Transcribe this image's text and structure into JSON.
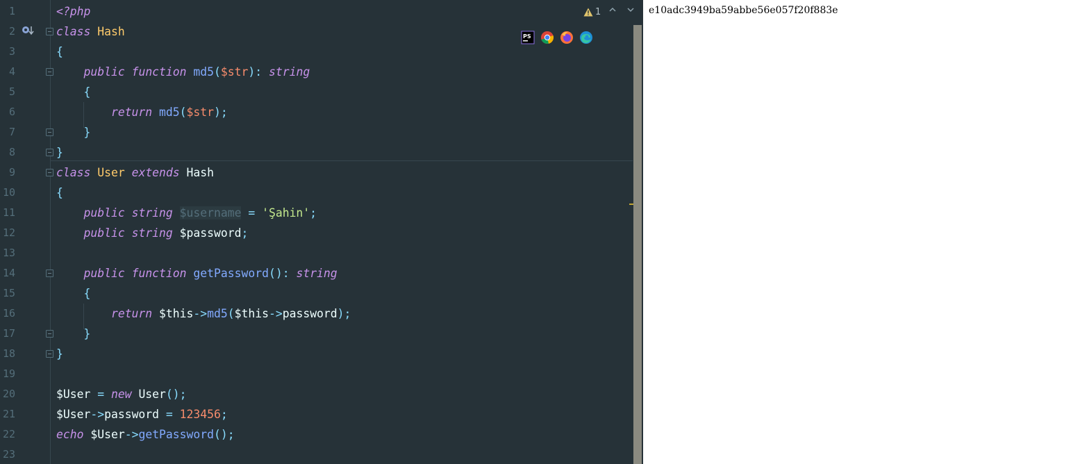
{
  "editor": {
    "line_numbers": [
      "1",
      "2",
      "3",
      "4",
      "5",
      "6",
      "7",
      "8",
      "9",
      "10",
      "11",
      "12",
      "13",
      "14",
      "15",
      "16",
      "17",
      "18",
      "19",
      "20",
      "21",
      "22",
      "23"
    ],
    "inspection": {
      "count": "1"
    },
    "browser_icons": [
      "phpstorm-icon",
      "chrome-icon",
      "firefox-icon",
      "edge-icon"
    ],
    "lines": [
      [
        {
          "t": "<?php",
          "c": "php"
        }
      ],
      [
        {
          "t": "class",
          "c": "kw"
        },
        {
          "t": " ",
          "c": "base"
        },
        {
          "t": "Hash",
          "c": "cls"
        }
      ],
      [
        {
          "t": "{",
          "c": "op"
        }
      ],
      [
        {
          "t": "    ",
          "c": "base"
        },
        {
          "t": "public",
          "c": "kw"
        },
        {
          "t": " ",
          "c": "base"
        },
        {
          "t": "function",
          "c": "kw"
        },
        {
          "t": " ",
          "c": "base"
        },
        {
          "t": "md5",
          "c": "fn"
        },
        {
          "t": "(",
          "c": "op"
        },
        {
          "t": "$str",
          "c": "var"
        },
        {
          "t": "): ",
          "c": "op"
        },
        {
          "t": "string",
          "c": "kw"
        }
      ],
      [
        {
          "t": "    ",
          "c": "base"
        },
        {
          "t": "{",
          "c": "op"
        }
      ],
      [
        {
          "t": "        ",
          "c": "base"
        },
        {
          "t": "return",
          "c": "kw"
        },
        {
          "t": " ",
          "c": "base"
        },
        {
          "t": "md5",
          "c": "fn"
        },
        {
          "t": "(",
          "c": "op"
        },
        {
          "t": "$str",
          "c": "var"
        },
        {
          "t": ");",
          "c": "op"
        }
      ],
      [
        {
          "t": "    ",
          "c": "base"
        },
        {
          "t": "}",
          "c": "op"
        }
      ],
      [
        {
          "t": "}",
          "c": "op"
        }
      ],
      [
        {
          "t": "class",
          "c": "kw"
        },
        {
          "t": " ",
          "c": "base"
        },
        {
          "t": "User",
          "c": "cls"
        },
        {
          "t": " ",
          "c": "base"
        },
        {
          "t": "extends",
          "c": "kw"
        },
        {
          "t": " ",
          "c": "base"
        },
        {
          "t": "Hash",
          "c": "plain"
        }
      ],
      [
        {
          "t": "{",
          "c": "op"
        }
      ],
      [
        {
          "t": "    ",
          "c": "base"
        },
        {
          "t": "public",
          "c": "kw"
        },
        {
          "t": " ",
          "c": "base"
        },
        {
          "t": "string",
          "c": "kw"
        },
        {
          "t": " ",
          "c": "base"
        },
        {
          "t": "$username",
          "c": "dim"
        },
        {
          "t": " = ",
          "c": "op"
        },
        {
          "t": "'Şahin'",
          "c": "str"
        },
        {
          "t": ";",
          "c": "op"
        }
      ],
      [
        {
          "t": "    ",
          "c": "base"
        },
        {
          "t": "public",
          "c": "kw"
        },
        {
          "t": " ",
          "c": "base"
        },
        {
          "t": "string",
          "c": "kw"
        },
        {
          "t": " ",
          "c": "base"
        },
        {
          "t": "$password",
          "c": "plain"
        },
        {
          "t": ";",
          "c": "op"
        }
      ],
      [],
      [
        {
          "t": "    ",
          "c": "base"
        },
        {
          "t": "public",
          "c": "kw"
        },
        {
          "t": " ",
          "c": "base"
        },
        {
          "t": "function",
          "c": "kw"
        },
        {
          "t": " ",
          "c": "base"
        },
        {
          "t": "getPassword",
          "c": "fn"
        },
        {
          "t": "(): ",
          "c": "op"
        },
        {
          "t": "string",
          "c": "kw"
        }
      ],
      [
        {
          "t": "    ",
          "c": "base"
        },
        {
          "t": "{",
          "c": "op"
        }
      ],
      [
        {
          "t": "        ",
          "c": "base"
        },
        {
          "t": "return",
          "c": "kw"
        },
        {
          "t": " ",
          "c": "base"
        },
        {
          "t": "$this",
          "c": "plain"
        },
        {
          "t": "->",
          "c": "op"
        },
        {
          "t": "md5",
          "c": "fn"
        },
        {
          "t": "(",
          "c": "op"
        },
        {
          "t": "$this",
          "c": "plain"
        },
        {
          "t": "->",
          "c": "op"
        },
        {
          "t": "password",
          "c": "plain"
        },
        {
          "t": ");",
          "c": "op"
        }
      ],
      [
        {
          "t": "    ",
          "c": "base"
        },
        {
          "t": "}",
          "c": "op"
        }
      ],
      [
        {
          "t": "}",
          "c": "op"
        }
      ],
      [],
      [
        {
          "t": "$User",
          "c": "plain"
        },
        {
          "t": " = ",
          "c": "op"
        },
        {
          "t": "new",
          "c": "kw"
        },
        {
          "t": " ",
          "c": "base"
        },
        {
          "t": "User",
          "c": "plain"
        },
        {
          "t": "();",
          "c": "op"
        }
      ],
      [
        {
          "t": "$User",
          "c": "plain"
        },
        {
          "t": "->",
          "c": "op"
        },
        {
          "t": "password",
          "c": "plain"
        },
        {
          "t": " = ",
          "c": "op"
        },
        {
          "t": "123456",
          "c": "num"
        },
        {
          "t": ";",
          "c": "op"
        }
      ],
      [
        {
          "t": "echo",
          "c": "kw"
        },
        {
          "t": " ",
          "c": "base"
        },
        {
          "t": "$User",
          "c": "plain"
        },
        {
          "t": "->",
          "c": "op"
        },
        {
          "t": "getPassword",
          "c": "fn"
        },
        {
          "t": "();",
          "c": "op"
        }
      ],
      []
    ]
  },
  "output": {
    "text": "e10adc3949ba59abbe56e057f20f883e"
  }
}
